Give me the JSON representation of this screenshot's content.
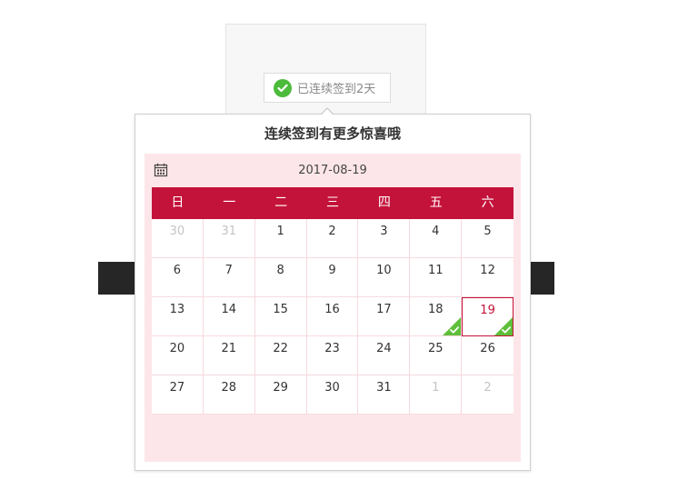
{
  "status": {
    "label": "已连续签到2天"
  },
  "popup": {
    "title": "连续签到有更多惊喜哦",
    "current_date": "2017-08-19"
  },
  "calendar": {
    "weekdays": [
      "日",
      "一",
      "二",
      "三",
      "四",
      "五",
      "六"
    ],
    "days": [
      {
        "n": "30",
        "muted": true
      },
      {
        "n": "31",
        "muted": true
      },
      {
        "n": "1"
      },
      {
        "n": "2"
      },
      {
        "n": "3"
      },
      {
        "n": "4"
      },
      {
        "n": "5"
      },
      {
        "n": "6"
      },
      {
        "n": "7"
      },
      {
        "n": "8"
      },
      {
        "n": "9"
      },
      {
        "n": "10"
      },
      {
        "n": "11"
      },
      {
        "n": "12"
      },
      {
        "n": "13"
      },
      {
        "n": "14"
      },
      {
        "n": "15"
      },
      {
        "n": "16"
      },
      {
        "n": "17"
      },
      {
        "n": "18",
        "signed": true
      },
      {
        "n": "19",
        "signed": true,
        "today": true
      },
      {
        "n": "20"
      },
      {
        "n": "21"
      },
      {
        "n": "22"
      },
      {
        "n": "23"
      },
      {
        "n": "24"
      },
      {
        "n": "25"
      },
      {
        "n": "26"
      },
      {
        "n": "27"
      },
      {
        "n": "28"
      },
      {
        "n": "29"
      },
      {
        "n": "30"
      },
      {
        "n": "31"
      },
      {
        "n": "1",
        "muted": true
      },
      {
        "n": "2",
        "muted": true
      }
    ]
  },
  "colors": {
    "accent": "#c4133a",
    "signed": "#5fbf3a",
    "calendar_bg": "#fce6e9"
  },
  "icons": {
    "status": "check-circle-icon",
    "calendar": "calendar-icon",
    "signed_day": "check-icon"
  }
}
